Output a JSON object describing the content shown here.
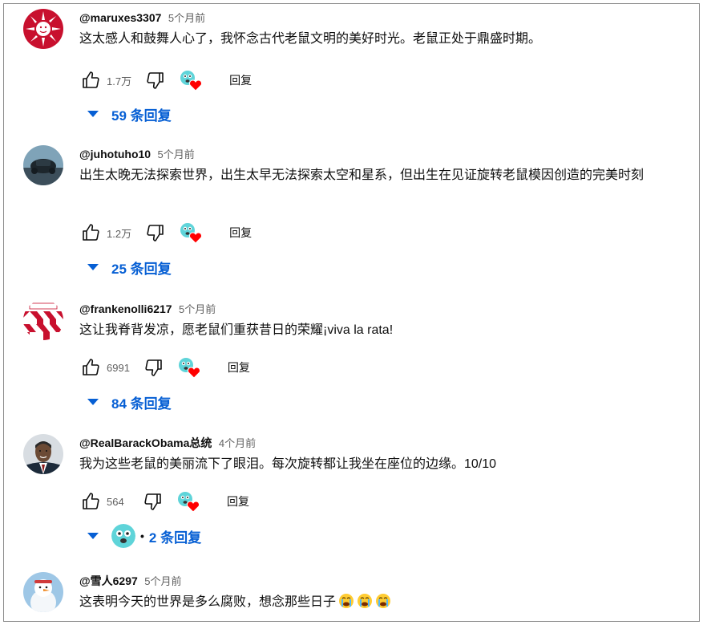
{
  "comments": [
    {
      "handle": "@maruxes3307",
      "time": "5个月前",
      "text": "这太感人和鼓舞人心了，我怀念古代老鼠文明的美好时光。老鼠正处于鼎盛时期。",
      "likes": "1.7万",
      "reply_label": "回复",
      "replies_label": "59 条回复"
    },
    {
      "handle": "@juhotuho10",
      "time": "5个月前",
      "text": "出生太晚无法探索世界，出生太早无法探索太空和星系，但出生在见证旋转老鼠模因创造的完美时刻",
      "likes": "1.2万",
      "reply_label": "回复",
      "replies_label": "25 条回复"
    },
    {
      "handle": "@frankenolli6217",
      "time": "5个月前",
      "text": "这让我脊背发凉，愿老鼠们重获昔日的荣耀¡viva la rata!",
      "likes": "6991",
      "reply_label": "回复",
      "replies_label": "84 条回复"
    },
    {
      "handle": "@RealBarackObama总统",
      "time": "4个月前",
      "text": "我为这些老鼠的美丽流下了眼泪。每次旋转都让我坐在座位的边缘。10/10",
      "likes": "564",
      "reply_label": "回复",
      "replies_label": "2 条回复",
      "replies_dot": "•"
    },
    {
      "handle": "@雪人6297",
      "time": "5个月前",
      "text": "这表明今天的世界是多么腐败，想念那些日子",
      "emoji": [
        "loudly-crying-face",
        "loudly-crying-face",
        "loudly-crying-face"
      ]
    }
  ],
  "colors": {
    "link_blue": "#065fd4",
    "heart_red": "#ff0000",
    "muted": "#606060"
  },
  "icons": {
    "like": "thumb-up-icon",
    "dislike": "thumb-down-icon",
    "creator_heart": "creator-heart-icon",
    "expand": "caret-down-icon"
  }
}
